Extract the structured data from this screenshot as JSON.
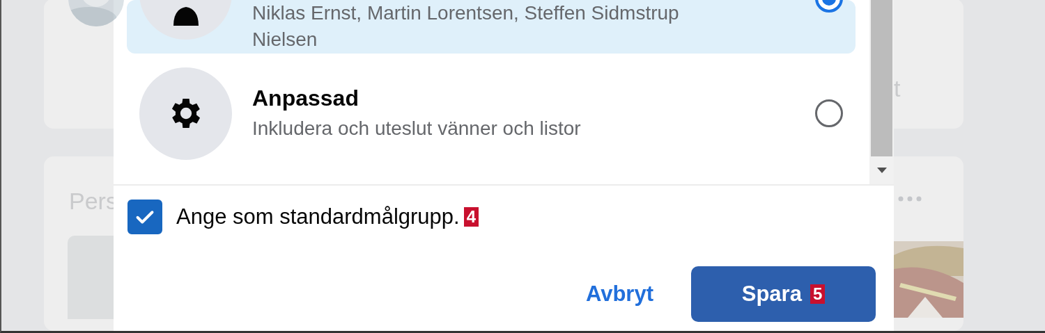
{
  "background": {
    "left_card_text": "Pers",
    "right_card_text": "t"
  },
  "audience_options": [
    {
      "kind": "person",
      "description": "Niklas Ernst, Martin Lorentsen, Steffen Sidmstrup Nielsen",
      "selected": true
    },
    {
      "kind": "gear",
      "title": "Anpassad",
      "description": "Inkludera och uteslut vänner och listor",
      "selected": false
    }
  ],
  "default_checkbox": {
    "label": "Ange som standardmålgrupp.",
    "checked": true,
    "badge": "4"
  },
  "buttons": [
    {
      "kind": "link",
      "label": "Avbryt"
    },
    {
      "kind": "primary",
      "label": "Spara",
      "badge": "5"
    }
  ]
}
